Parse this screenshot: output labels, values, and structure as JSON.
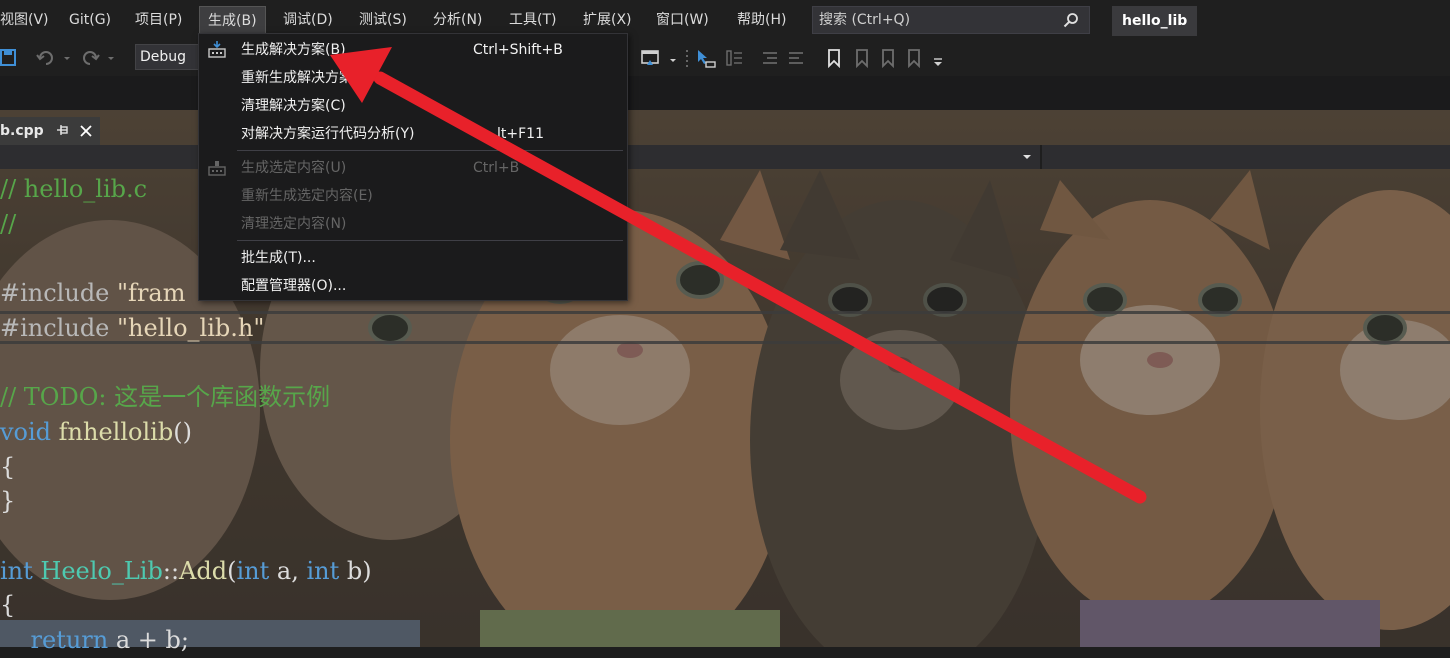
{
  "menubar": {
    "items": [
      {
        "label": "视图(V)"
      },
      {
        "label": "Git(G)"
      },
      {
        "label": "项目(P)"
      },
      {
        "label": "生成(B)"
      },
      {
        "label": "调试(D)"
      },
      {
        "label": "测试(S)"
      },
      {
        "label": "分析(N)"
      },
      {
        "label": "工具(T)"
      },
      {
        "label": "扩展(X)"
      },
      {
        "label": "窗口(W)"
      },
      {
        "label": "帮助(H)"
      }
    ],
    "search_placeholder": "搜索 (Ctrl+Q)",
    "project_title": "hello_lib"
  },
  "toolbar": {
    "configuration": "Debug"
  },
  "editor": {
    "tab_label": "b.cpp",
    "code": {
      "l1": "// hello_lib.c",
      "l2": "//",
      "l4a": "#include ",
      "l4b": "\"fram",
      "l5a": "#include ",
      "l5b": "\"hello_lib.h\"",
      "l7": "// TODO: 这是一个库函数示例",
      "l8a": "void",
      "l8b": " fnhellolib",
      "l8c": "()",
      "l9": "{",
      "l10": "}",
      "l12a": "int",
      "l12b": " Heelo_Lib",
      "l12c": "::",
      "l12d": "Add",
      "l12e": "(",
      "l12f": "int",
      "l12g": " a, ",
      "l12h": "int",
      "l12i": " b)",
      "l13": "{",
      "l14a": "    return",
      "l14b": " a + b;"
    }
  },
  "build_menu": {
    "items": [
      {
        "label": "生成解决方案(B)",
        "shortcut": "Ctrl+Shift+B"
      },
      {
        "label": "重新生成解决方案",
        "shortcut": ""
      },
      {
        "label": "清理解决方案(C)",
        "shortcut": ""
      },
      {
        "label": "对解决方案运行代码分析(Y)",
        "shortcut": "lt+F11"
      },
      {
        "label": "生成选定内容(U)",
        "shortcut": "Ctrl+B"
      },
      {
        "label": "重新生成选定内容(E)",
        "shortcut": ""
      },
      {
        "label": "清理选定内容(N)",
        "shortcut": ""
      },
      {
        "label": "批生成(T)...",
        "shortcut": ""
      },
      {
        "label": "配置管理器(O)...",
        "shortcut": ""
      }
    ]
  },
  "colors": {
    "accent_arrow": "#e8212a",
    "menu_bg": "#1b1b1c",
    "comment": "#57a64a",
    "keyword": "#569cd6"
  }
}
